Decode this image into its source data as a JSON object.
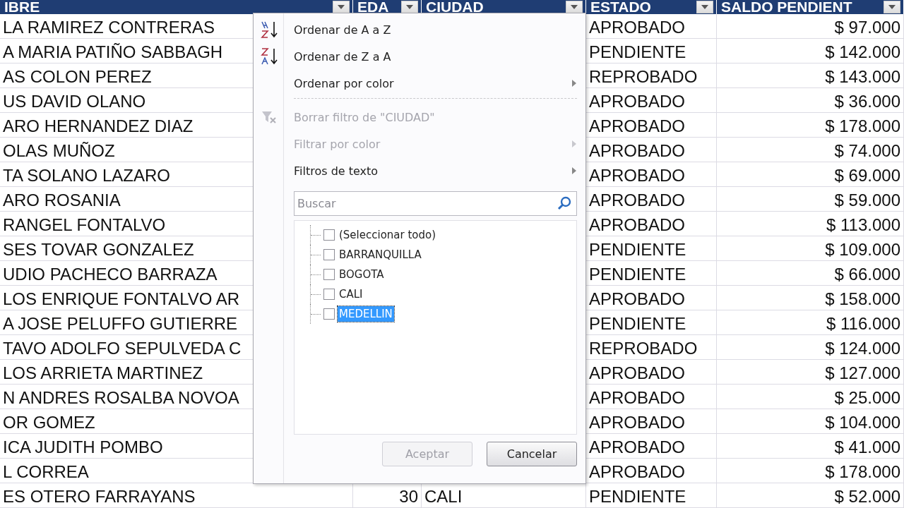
{
  "table": {
    "columns": [
      "IBRE",
      "EDA",
      "CIUDAD",
      "ESTADO",
      "SALDO PENDIENT"
    ],
    "rows": [
      {
        "name": "LA RAMIREZ CONTRERAS",
        "estado": "APROBADO",
        "saldo": "$ 97.000"
      },
      {
        "name": "A MARIA PATIÑO SABBAGH",
        "estado": "PENDIENTE",
        "saldo": "$ 142.000"
      },
      {
        "name": "AS COLON PEREZ",
        "estado": "REPROBADO",
        "saldo": "$ 143.000"
      },
      {
        "name": "US DAVID OLANO",
        "estado": "APROBADO",
        "saldo": "$ 36.000"
      },
      {
        "name": "ARO HERNANDEZ DIAZ",
        "estado": "APROBADO",
        "saldo": "$ 178.000"
      },
      {
        "name": "OLAS MUÑOZ",
        "estado": "APROBADO",
        "saldo": "$ 74.000"
      },
      {
        "name": "TA SOLANO LAZARO",
        "estado": "APROBADO",
        "saldo": "$ 69.000"
      },
      {
        "name": "ARO ROSANIA",
        "estado": "APROBADO",
        "saldo": "$ 59.000"
      },
      {
        "name": "RANGEL FONTALVO",
        "estado": "APROBADO",
        "saldo": "$ 113.000"
      },
      {
        "name": "SES TOVAR GONZALEZ",
        "estado": "PENDIENTE",
        "saldo": "$ 109.000"
      },
      {
        "name": "UDIO PACHECO BARRAZA",
        "estado": "PENDIENTE",
        "saldo": "$ 66.000"
      },
      {
        "name": "LOS ENRIQUE FONTALVO AR",
        "estado": "APROBADO",
        "saldo": "$ 158.000"
      },
      {
        "name": "A JOSE PELUFFO GUTIERRE",
        "estado": "PENDIENTE",
        "saldo": "$ 116.000"
      },
      {
        "name": "TAVO ADOLFO SEPULVEDA C",
        "estado": "REPROBADO",
        "saldo": "$ 124.000"
      },
      {
        "name": "LOS ARRIETA MARTINEZ",
        "estado": "APROBADO",
        "saldo": "$ 127.000"
      },
      {
        "name": "N ANDRES ROSALBA NOVOA",
        "estado": "APROBADO",
        "saldo": "$ 25.000"
      },
      {
        "name": "OR GOMEZ",
        "estado": "APROBADO",
        "saldo": "$ 104.000"
      },
      {
        "name": "ICA JUDITH POMBO",
        "estado": "APROBADO",
        "saldo": "$ 41.000"
      },
      {
        "name": "L CORREA",
        "estado": "APROBADO",
        "saldo": "$ 178.000"
      },
      {
        "name": "ES OTERO FARRAYANS",
        "edad": "30",
        "ciudad": "CALI",
        "estado": "PENDIENTE",
        "saldo": "$ 52.000"
      }
    ]
  },
  "filter_menu": {
    "items": [
      {
        "kind": "ascending",
        "label": "Ordenar de A a Z",
        "disabled": false,
        "submenu": false
      },
      {
        "kind": "descending",
        "label": "Ordenar de Z a A",
        "disabled": false,
        "submenu": false
      },
      {
        "kind": "item",
        "label": "Ordenar por color",
        "disabled": false,
        "submenu": true
      },
      {
        "kind": "separator"
      },
      {
        "kind": "clear",
        "label": "Borrar filtro de \"CIUDAD\"",
        "disabled": true,
        "submenu": false
      },
      {
        "kind": "item",
        "label": "Filtrar por color",
        "disabled": true,
        "submenu": true
      },
      {
        "kind": "item",
        "label": "Filtros de texto",
        "disabled": false,
        "submenu": true
      }
    ],
    "search": {
      "placeholder": "Buscar"
    },
    "values": [
      {
        "label": "(Seleccionar todo)",
        "checked": false,
        "selected": false
      },
      {
        "label": "BARRANQUILLA",
        "checked": false,
        "selected": false
      },
      {
        "label": "BOGOTA",
        "checked": false,
        "selected": false
      },
      {
        "label": "CALI",
        "checked": false,
        "selected": false
      },
      {
        "label": "MEDELLIN",
        "checked": false,
        "selected": true
      }
    ],
    "buttons": [
      {
        "label": "Aceptar",
        "disabled": true
      },
      {
        "label": "Cancelar",
        "disabled": false
      }
    ]
  }
}
